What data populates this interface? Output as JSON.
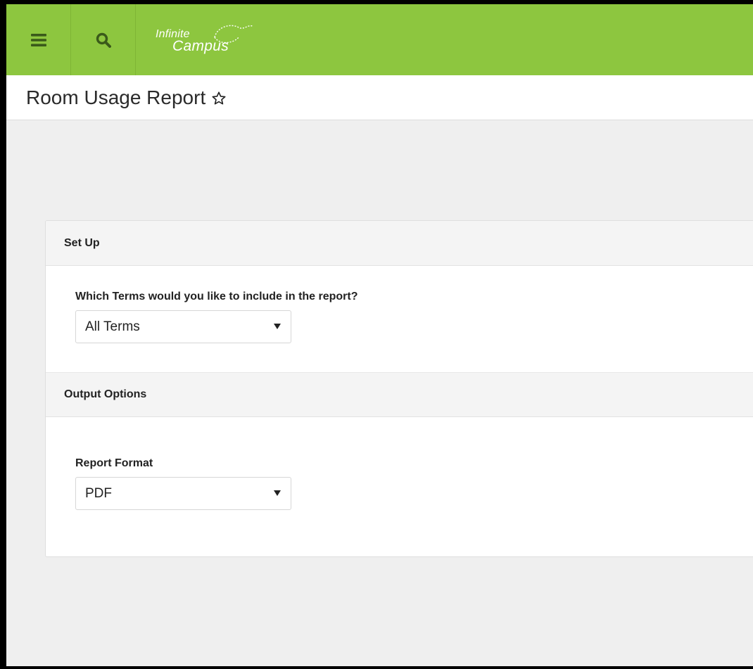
{
  "header": {
    "logo_line1": "Infinite",
    "logo_line2": "Campus",
    "brand_color": "#8dc63f",
    "icons": [
      "menu-icon",
      "search-icon"
    ]
  },
  "page": {
    "title": "Room Usage Report",
    "favorite_icon": "star-outline-icon"
  },
  "setup": {
    "heading": "Set Up",
    "terms_label": "Which Terms would you like to include in the report?",
    "terms_value": "All Terms"
  },
  "output": {
    "heading": "Output Options",
    "format_label": "Report Format",
    "format_value": "PDF"
  }
}
